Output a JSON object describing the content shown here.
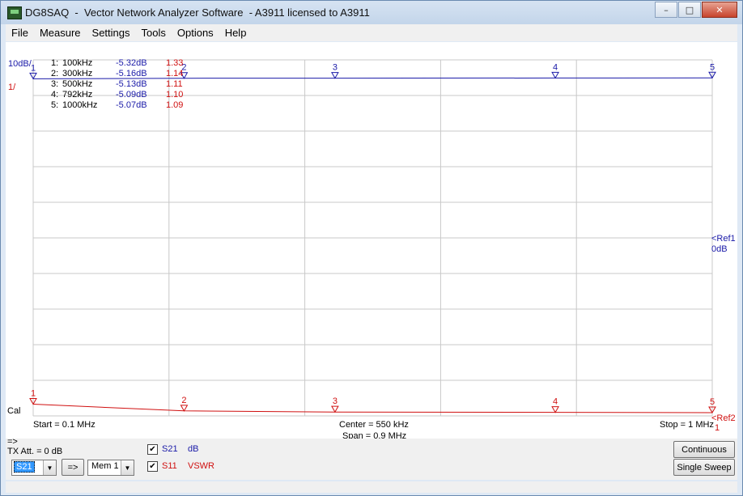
{
  "window": {
    "title": "DG8SAQ  -  Vector Network Analyzer Software  - A3911 licensed to A3911",
    "minimize": "–",
    "maximize": "□",
    "close": "✕"
  },
  "menu": [
    "File",
    "Measure",
    "Settings",
    "Tools",
    "Options",
    "Help"
  ],
  "scale": {
    "trace1": "10dB/",
    "trace2": "1/"
  },
  "markers": [
    {
      "num": "1:",
      "freq": "100kHz",
      "db": "-5.32dB",
      "vswr": "1.33"
    },
    {
      "num": "2:",
      "freq": "300kHz",
      "db": "-5.16dB",
      "vswr": "1.14"
    },
    {
      "num": "3:",
      "freq": "500kHz",
      "db": "-5.13dB",
      "vswr": "1.11"
    },
    {
      "num": "4:",
      "freq": "792kHz",
      "db": "-5.09dB",
      "vswr": "1.10"
    },
    {
      "num": "5:",
      "freq": "1000kHz",
      "db": "-5.07dB",
      "vswr": "1.09"
    }
  ],
  "marker_ids": [
    "1",
    "2",
    "3",
    "4",
    "5"
  ],
  "ref": {
    "ref1_a": "<Ref1",
    "ref1_b": "0dB",
    "ref2_a": "<Ref2",
    "ref2_b": "1"
  },
  "cal": "Cal",
  "freq": {
    "start": "Start = 0.1 MHz",
    "center": "Center = 550 kHz",
    "span": "Span = 0.9 MHz",
    "stop": "Stop = 1 MHz"
  },
  "controls": {
    "arrow_label": "=>",
    "tx_att": "TX Att.  = 0 dB",
    "trace_select": "S21",
    "copy_button": "=>",
    "mem_select": "Mem 1",
    "trace1_name": "S21",
    "trace1_unit": "dB",
    "trace2_name": "S11",
    "trace2_unit": "VSWR",
    "check_mark": "✔",
    "continuous": "Continuous",
    "single_sweep": "Single Sweep"
  },
  "colors": {
    "s21": "#1a1aa8",
    "s11": "#d01010",
    "grid": "#c8c8c8"
  },
  "chart_data": {
    "type": "line",
    "x_unit": "kHz",
    "xlim": [
      100,
      1000
    ],
    "series": [
      {
        "name": "S21",
        "unit": "dB",
        "x": [
          100,
          300,
          500,
          792,
          1000
        ],
        "values": [
          -5.32,
          -5.16,
          -5.13,
          -5.09,
          -5.07
        ],
        "ylim": [
          -100,
          0
        ]
      },
      {
        "name": "S11",
        "unit": "VSWR",
        "x": [
          100,
          300,
          500,
          792,
          1000
        ],
        "values": [
          1.33,
          1.14,
          1.11,
          1.1,
          1.09
        ],
        "ylim": [
          1,
          11
        ]
      }
    ]
  }
}
